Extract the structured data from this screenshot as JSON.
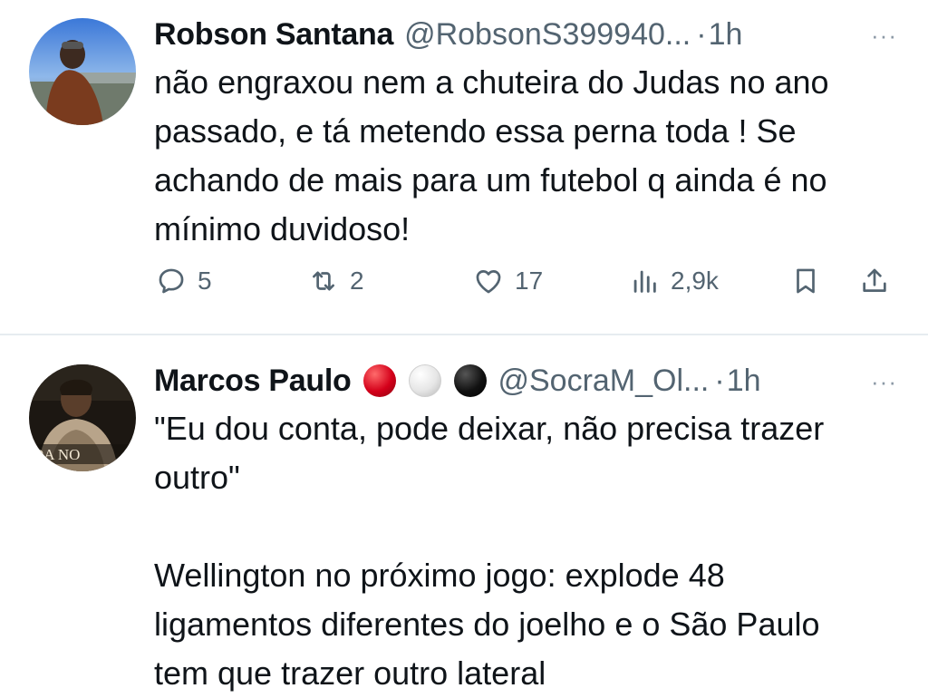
{
  "tweets": [
    {
      "name": "Robson Santana",
      "handle": "@RobsonS399940...",
      "dot": "·",
      "time": "1h",
      "more": "···",
      "text": "não engraxou nem a chuteira do Judas no ano\npassado, e tá metendo essa perna toda ! Se\nachando de mais para um futebol q ainda é no\nmínimo duvidoso!",
      "actions": {
        "replies": "5",
        "retweets": "2",
        "likes": "17",
        "views": "2,9k"
      },
      "icons": [
        "reply-icon",
        "retweet-icon",
        "like-icon",
        "views-icon",
        "bookmark-icon",
        "share-icon"
      ]
    },
    {
      "name": "Marcos Paulo",
      "handle": "@SocraM_Ol...",
      "dot": "·",
      "time": "1h",
      "more": "···",
      "name_emojis": [
        "red-circle",
        "white-circle",
        "black-circle"
      ],
      "avatar_caption": "OA NO",
      "text": "\"Eu dou conta, pode deixar, não precisa trazer\noutro\"\n\nWellington no próximo jogo: explode 48\nligamentos diferentes do joelho e o São Paulo\ntem que trazer outro lateral"
    }
  ],
  "colors": {
    "text": "#0f1419",
    "muted": "#536471",
    "divider": "#e6ecf0",
    "red": "#d4001a"
  }
}
